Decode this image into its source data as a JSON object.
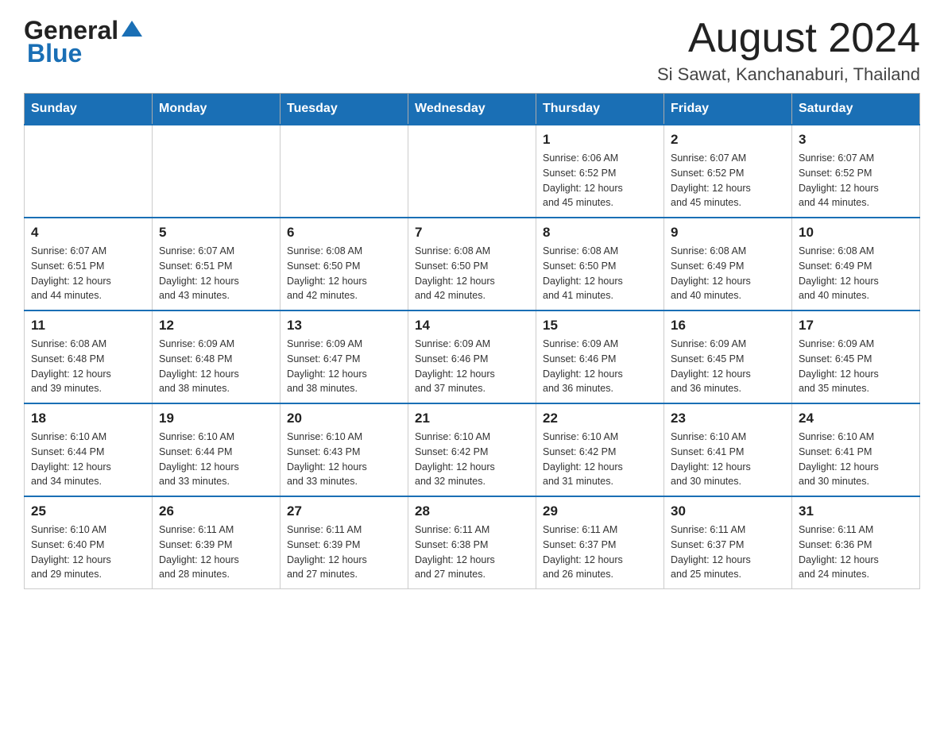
{
  "header": {
    "logo": {
      "general": "General",
      "blue": "Blue",
      "tagline": ""
    },
    "title": "August 2024",
    "location": "Si Sawat, Kanchanaburi, Thailand"
  },
  "weekdays": [
    "Sunday",
    "Monday",
    "Tuesday",
    "Wednesday",
    "Thursday",
    "Friday",
    "Saturday"
  ],
  "weeks": [
    [
      {
        "day": "",
        "info": ""
      },
      {
        "day": "",
        "info": ""
      },
      {
        "day": "",
        "info": ""
      },
      {
        "day": "",
        "info": ""
      },
      {
        "day": "1",
        "info": "Sunrise: 6:06 AM\nSunset: 6:52 PM\nDaylight: 12 hours\nand 45 minutes."
      },
      {
        "day": "2",
        "info": "Sunrise: 6:07 AM\nSunset: 6:52 PM\nDaylight: 12 hours\nand 45 minutes."
      },
      {
        "day": "3",
        "info": "Sunrise: 6:07 AM\nSunset: 6:52 PM\nDaylight: 12 hours\nand 44 minutes."
      }
    ],
    [
      {
        "day": "4",
        "info": "Sunrise: 6:07 AM\nSunset: 6:51 PM\nDaylight: 12 hours\nand 44 minutes."
      },
      {
        "day": "5",
        "info": "Sunrise: 6:07 AM\nSunset: 6:51 PM\nDaylight: 12 hours\nand 43 minutes."
      },
      {
        "day": "6",
        "info": "Sunrise: 6:08 AM\nSunset: 6:50 PM\nDaylight: 12 hours\nand 42 minutes."
      },
      {
        "day": "7",
        "info": "Sunrise: 6:08 AM\nSunset: 6:50 PM\nDaylight: 12 hours\nand 42 minutes."
      },
      {
        "day": "8",
        "info": "Sunrise: 6:08 AM\nSunset: 6:50 PM\nDaylight: 12 hours\nand 41 minutes."
      },
      {
        "day": "9",
        "info": "Sunrise: 6:08 AM\nSunset: 6:49 PM\nDaylight: 12 hours\nand 40 minutes."
      },
      {
        "day": "10",
        "info": "Sunrise: 6:08 AM\nSunset: 6:49 PM\nDaylight: 12 hours\nand 40 minutes."
      }
    ],
    [
      {
        "day": "11",
        "info": "Sunrise: 6:08 AM\nSunset: 6:48 PM\nDaylight: 12 hours\nand 39 minutes."
      },
      {
        "day": "12",
        "info": "Sunrise: 6:09 AM\nSunset: 6:48 PM\nDaylight: 12 hours\nand 38 minutes."
      },
      {
        "day": "13",
        "info": "Sunrise: 6:09 AM\nSunset: 6:47 PM\nDaylight: 12 hours\nand 38 minutes."
      },
      {
        "day": "14",
        "info": "Sunrise: 6:09 AM\nSunset: 6:46 PM\nDaylight: 12 hours\nand 37 minutes."
      },
      {
        "day": "15",
        "info": "Sunrise: 6:09 AM\nSunset: 6:46 PM\nDaylight: 12 hours\nand 36 minutes."
      },
      {
        "day": "16",
        "info": "Sunrise: 6:09 AM\nSunset: 6:45 PM\nDaylight: 12 hours\nand 36 minutes."
      },
      {
        "day": "17",
        "info": "Sunrise: 6:09 AM\nSunset: 6:45 PM\nDaylight: 12 hours\nand 35 minutes."
      }
    ],
    [
      {
        "day": "18",
        "info": "Sunrise: 6:10 AM\nSunset: 6:44 PM\nDaylight: 12 hours\nand 34 minutes."
      },
      {
        "day": "19",
        "info": "Sunrise: 6:10 AM\nSunset: 6:44 PM\nDaylight: 12 hours\nand 33 minutes."
      },
      {
        "day": "20",
        "info": "Sunrise: 6:10 AM\nSunset: 6:43 PM\nDaylight: 12 hours\nand 33 minutes."
      },
      {
        "day": "21",
        "info": "Sunrise: 6:10 AM\nSunset: 6:42 PM\nDaylight: 12 hours\nand 32 minutes."
      },
      {
        "day": "22",
        "info": "Sunrise: 6:10 AM\nSunset: 6:42 PM\nDaylight: 12 hours\nand 31 minutes."
      },
      {
        "day": "23",
        "info": "Sunrise: 6:10 AM\nSunset: 6:41 PM\nDaylight: 12 hours\nand 30 minutes."
      },
      {
        "day": "24",
        "info": "Sunrise: 6:10 AM\nSunset: 6:41 PM\nDaylight: 12 hours\nand 30 minutes."
      }
    ],
    [
      {
        "day": "25",
        "info": "Sunrise: 6:10 AM\nSunset: 6:40 PM\nDaylight: 12 hours\nand 29 minutes."
      },
      {
        "day": "26",
        "info": "Sunrise: 6:11 AM\nSunset: 6:39 PM\nDaylight: 12 hours\nand 28 minutes."
      },
      {
        "day": "27",
        "info": "Sunrise: 6:11 AM\nSunset: 6:39 PM\nDaylight: 12 hours\nand 27 minutes."
      },
      {
        "day": "28",
        "info": "Sunrise: 6:11 AM\nSunset: 6:38 PM\nDaylight: 12 hours\nand 27 minutes."
      },
      {
        "day": "29",
        "info": "Sunrise: 6:11 AM\nSunset: 6:37 PM\nDaylight: 12 hours\nand 26 minutes."
      },
      {
        "day": "30",
        "info": "Sunrise: 6:11 AM\nSunset: 6:37 PM\nDaylight: 12 hours\nand 25 minutes."
      },
      {
        "day": "31",
        "info": "Sunrise: 6:11 AM\nSunset: 6:36 PM\nDaylight: 12 hours\nand 24 minutes."
      }
    ]
  ]
}
